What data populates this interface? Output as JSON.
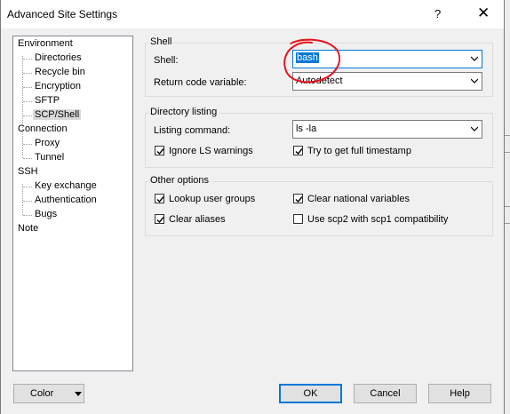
{
  "window": {
    "title": "Advanced Site Settings",
    "help_glyph": "?",
    "close_glyph": "✕"
  },
  "tree": {
    "items": [
      {
        "label": "Environment",
        "level": 0
      },
      {
        "label": "Directories",
        "level": 1
      },
      {
        "label": "Recycle bin",
        "level": 1
      },
      {
        "label": "Encryption",
        "level": 1
      },
      {
        "label": "SFTP",
        "level": 1
      },
      {
        "label": "SCP/Shell",
        "level": 1,
        "selected": true
      },
      {
        "label": "Connection",
        "level": 0
      },
      {
        "label": "Proxy",
        "level": 1
      },
      {
        "label": "Tunnel",
        "level": 1
      },
      {
        "label": "SSH",
        "level": 0
      },
      {
        "label": "Key exchange",
        "level": 1
      },
      {
        "label": "Authentication",
        "level": 1
      },
      {
        "label": "Bugs",
        "level": 1
      },
      {
        "label": "Note",
        "level": 0
      }
    ]
  },
  "shell_group": {
    "title": "Shell",
    "shell_label": "Shell:",
    "shell_value": "bash",
    "return_code_label": "Return code variable:",
    "return_code_value": "Autodetect"
  },
  "dir_group": {
    "title": "Directory listing",
    "listing_label": "Listing command:",
    "listing_value": "ls -la",
    "ignore_ls": {
      "label": "Ignore LS warnings",
      "checked": true
    },
    "full_timestamp": {
      "label": "Try to get full timestamp",
      "checked": true
    }
  },
  "other_group": {
    "title": "Other options",
    "lookup_groups": {
      "label": "Lookup user groups",
      "checked": true
    },
    "clear_national": {
      "label": "Clear national variables",
      "checked": true
    },
    "clear_aliases": {
      "label": "Clear aliases",
      "checked": true
    },
    "use_scp2": {
      "label": "Use scp2 with scp1 compatibility",
      "checked": false
    }
  },
  "buttons": {
    "color": "Color",
    "ok": "OK",
    "cancel": "Cancel",
    "help": "Help"
  },
  "colors": {
    "accent": "#0078d7",
    "annotation": "#e8141e",
    "selection": "#d9d9d9"
  }
}
